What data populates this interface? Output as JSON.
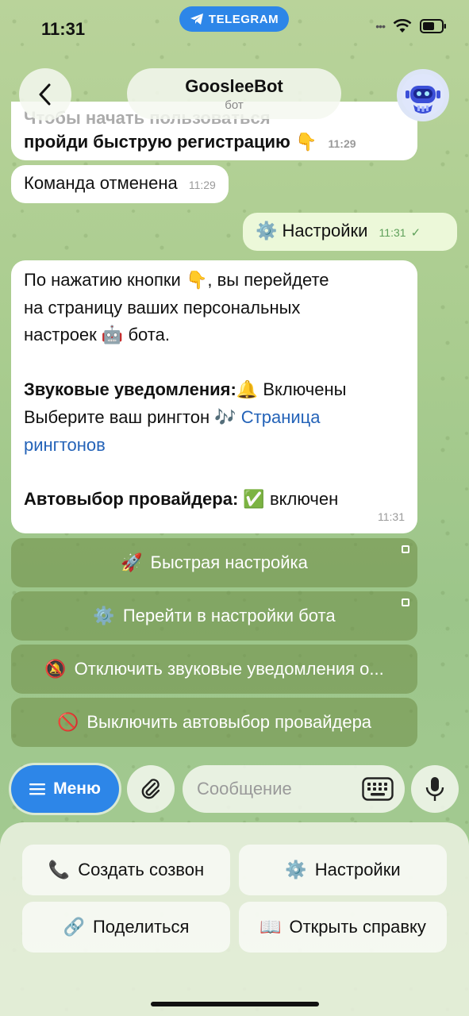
{
  "status_bar": {
    "time": "11:31",
    "app_pill": "TELEGRAM"
  },
  "header": {
    "bot_name": "GoosleeBot",
    "bot_subtitle": "бот"
  },
  "messages": {
    "partial_top": {
      "line1": "Чтобы начать пользоваться",
      "line2": "пройди быструю регистрацию",
      "emoji": "👇",
      "time": "11:29"
    },
    "cancelled": {
      "text": "Команда отменена",
      "time": "11:29"
    },
    "settings_out": {
      "emoji": "⚙️",
      "text": "Настройки",
      "time": "11:31"
    },
    "settings_info": {
      "p1_a": "По нажатию кнопки",
      "p1_emoji": "👇",
      "p1_b": ", вы перейдете",
      "p1_c": "на страницу ваших персональных",
      "p1_d": "настроек",
      "p1_robot": "🤖",
      "p1_e": "бота.",
      "sound_label": "Звуковые уведомления:",
      "sound_emoji": "🔔",
      "sound_value": "Включены",
      "ringtone_a": "Выберите ваш рингтон",
      "ringtone_emoji": "🎶",
      "ringtone_link1": "Страница",
      "ringtone_link2": "рингтонов",
      "provider_label": "Автовыбор провайдера:",
      "provider_emoji": "✅",
      "provider_value": "включен",
      "time": "11:31"
    }
  },
  "inline_buttons": [
    {
      "emoji": "🚀",
      "label": "Быстрая настройка"
    },
    {
      "emoji": "⚙️",
      "label": "Перейти в настройки бота"
    },
    {
      "emoji": "🔕",
      "label": "Отключить звуковые уведомления о..."
    },
    {
      "emoji": "🚫",
      "label": "Выключить автовыбор провайдера"
    }
  ],
  "composer": {
    "menu_label": "Меню",
    "placeholder": "Сообщение"
  },
  "reply_keyboard": [
    {
      "emoji": "📞",
      "label": "Создать созвон"
    },
    {
      "emoji": "⚙️",
      "label": "Настройки"
    },
    {
      "emoji": "🔗",
      "label": "Поделиться"
    },
    {
      "emoji": "📖",
      "label": "Открыть справку"
    }
  ],
  "colors": {
    "accent": "#2d86e8",
    "link": "#2463b8",
    "outgoing_bubble": "#ecf8d9"
  }
}
